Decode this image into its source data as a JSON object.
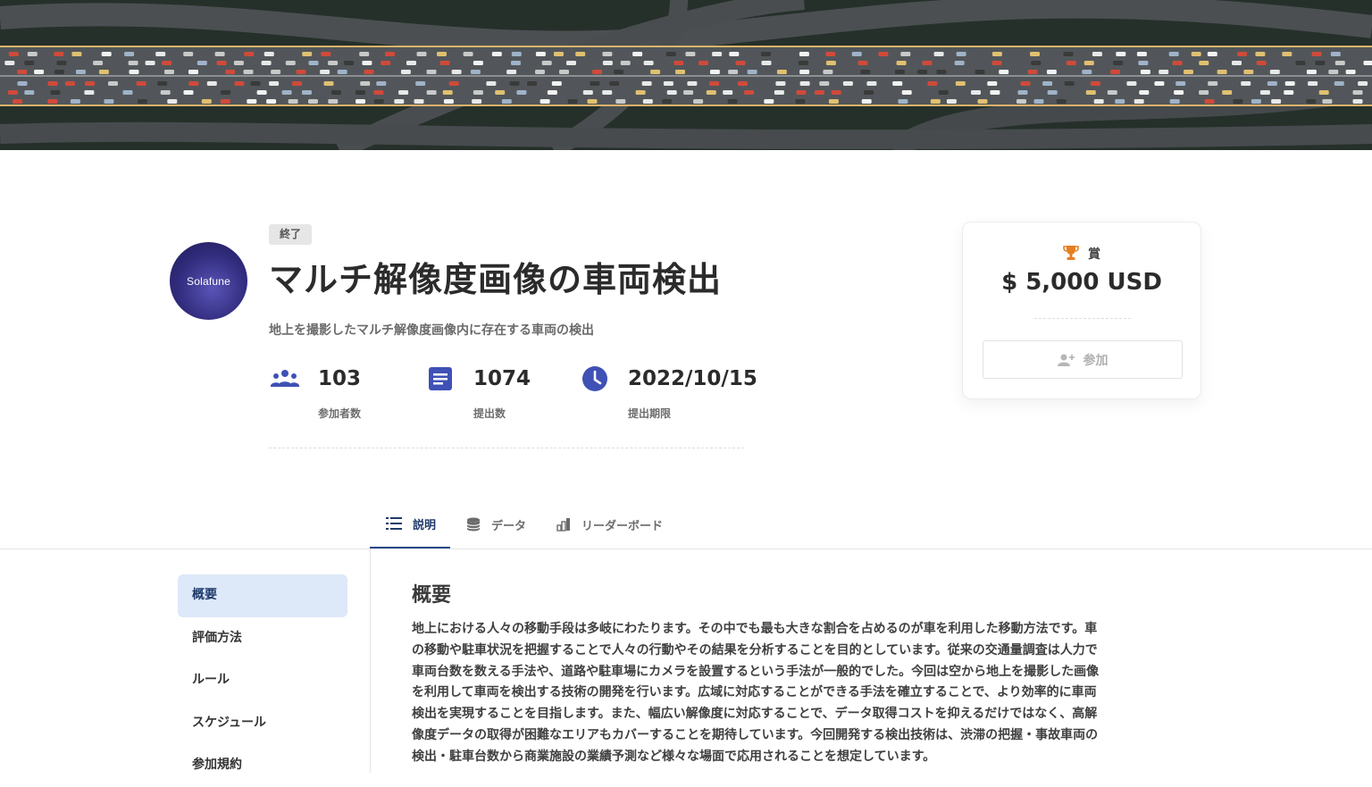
{
  "competition": {
    "status": "終了",
    "title": "マルチ解像度画像の車両検出",
    "subtitle": "地上を撮影したマルチ解像度画像内に存在する車両の検出",
    "logo_text": "Solafune"
  },
  "stats": [
    {
      "value": "103",
      "label": "参加者数",
      "icon": "users-icon"
    },
    {
      "value": "1074",
      "label": "提出数",
      "icon": "document-icon"
    },
    {
      "value": "2022/10/15",
      "label": "提出期限",
      "icon": "clock-icon"
    }
  ],
  "prize": {
    "label": "賞",
    "amount": "$ 5,000 USD",
    "join_label": "参加"
  },
  "tabs": [
    {
      "label": "説明",
      "icon": "list-icon",
      "active": true
    },
    {
      "label": "データ",
      "icon": "database-icon",
      "active": false
    },
    {
      "label": "リーダーボード",
      "icon": "leaderboard-icon",
      "active": false
    }
  ],
  "sidenav": [
    {
      "label": "概要",
      "active": true
    },
    {
      "label": "評価方法",
      "active": false
    },
    {
      "label": "ルール",
      "active": false
    },
    {
      "label": "スケジュール",
      "active": false
    },
    {
      "label": "参加規約",
      "active": false
    }
  ],
  "content": {
    "heading": "概要",
    "lines": [
      "地上における人々の移動手段は多岐にわたります。その中でも最も大きな割合を占めるのが車を利用した移動方法です。車",
      "の移動や駐車状況を把握することで人々の行動やその結果を分析することを目的としています。従来の交通量調査は人力で",
      "車両台数を数える手法や、道路や駐車場にカメラを設置するという手法が一般的でした。今回は空から地上を撮影した画像",
      "を利用して車両を検出する技術の開発を行います。広域に対応することができる手法を確立することで、より効率的に車両",
      "検出を実現することを目指します。また、幅広い解像度に対応することで、データ取得コストを抑えるだけではなく、高解",
      "像度データの取得が困難なエリアもカバーすることを期待しています。今回開発する検出技術は、渋滞の把握・事故車両の",
      "検出・駐車台数から商業施設の業績予測など様々な場面で応用されることを想定しています。"
    ]
  },
  "colors": {
    "accent": "#2a4a8a",
    "stat_icon": "#3f51b5",
    "trophy": "#e67e22",
    "active_bg": "#dde8f9"
  }
}
